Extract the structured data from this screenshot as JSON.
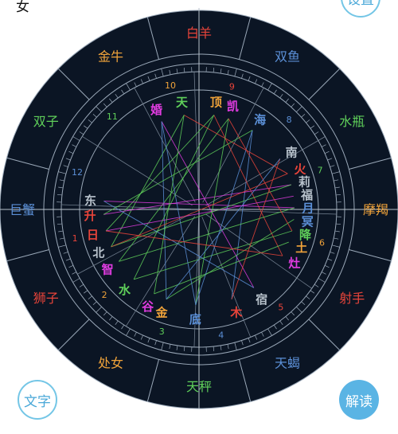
{
  "header": {
    "gender": "女"
  },
  "buttons": {
    "settings": "设置",
    "text": "文字",
    "interpret": "解读"
  },
  "colors": {
    "chart_bg": "#0b1524",
    "ring_line": "#9aa8b8",
    "button_accent": "#5ab4e4"
  },
  "signs": [
    {
      "name": "白羊",
      "color": "#e8443a"
    },
    {
      "name": "双鱼",
      "color": "#5b8fd6"
    },
    {
      "name": "水瓶",
      "color": "#5fcf5a"
    },
    {
      "name": "摩羯",
      "color": "#f0a33a"
    },
    {
      "name": "射手",
      "color": "#e8443a"
    },
    {
      "name": "天蝎",
      "color": "#5b8fd6"
    },
    {
      "name": "天秤",
      "color": "#5fcf5a"
    },
    {
      "name": "处女",
      "color": "#f0a33a"
    },
    {
      "name": "狮子",
      "color": "#e8443a"
    },
    {
      "name": "巨蟹",
      "color": "#5b8fd6"
    },
    {
      "name": "双子",
      "color": "#5fcf5a"
    },
    {
      "name": "金牛",
      "color": "#f0a33a"
    }
  ],
  "houses": [
    {
      "num": "10",
      "color": "#f0a33a"
    },
    {
      "num": "9",
      "color": "#e8443a"
    },
    {
      "num": "8",
      "color": "#5b8fd6"
    },
    {
      "num": "7",
      "color": "#5fcf5a"
    },
    {
      "num": "6",
      "color": "#f0a33a"
    },
    {
      "num": "5",
      "color": "#e8443a"
    },
    {
      "num": "4",
      "color": "#5b8fd6"
    },
    {
      "num": "3",
      "color": "#5fcf5a"
    },
    {
      "num": "2",
      "color": "#f0a33a"
    },
    {
      "num": "1",
      "color": "#e8443a"
    },
    {
      "num": "12",
      "color": "#5b8fd6"
    },
    {
      "num": "11",
      "color": "#5fcf5a"
    }
  ],
  "bodies": [
    {
      "id": "hun",
      "label": "婚",
      "color": "#e03ce0"
    },
    {
      "id": "tian",
      "label": "天",
      "color": "#5fcf5a"
    },
    {
      "id": "ding",
      "label": "顶",
      "color": "#f0a33a"
    },
    {
      "id": "kai",
      "label": "凯",
      "color": "#e03ce0"
    },
    {
      "id": "hai",
      "label": "海",
      "color": "#5b8fd6"
    },
    {
      "id": "nan",
      "label": "南",
      "color": "#b8c2cc"
    },
    {
      "id": "huo",
      "label": "火",
      "color": "#e8443a"
    },
    {
      "id": "li",
      "label": "莉",
      "color": "#b8c2cc"
    },
    {
      "id": "fu",
      "label": "福",
      "color": "#b8c2cc"
    },
    {
      "id": "yue",
      "label": "月",
      "color": "#5b8fd6"
    },
    {
      "id": "ming",
      "label": "冥",
      "color": "#5b8fd6"
    },
    {
      "id": "jiang",
      "label": "降",
      "color": "#5fcf5a"
    },
    {
      "id": "tu",
      "label": "土",
      "color": "#f0a33a"
    },
    {
      "id": "zao",
      "label": "灶",
      "color": "#e03ce0"
    },
    {
      "id": "su",
      "label": "宿",
      "color": "#b8c2cc"
    },
    {
      "id": "mu",
      "label": "木",
      "color": "#e8443a"
    },
    {
      "id": "di",
      "label": "底",
      "color": "#5b8fd6"
    },
    {
      "id": "jin",
      "label": "金",
      "color": "#f0a33a"
    },
    {
      "id": "gu",
      "label": "谷",
      "color": "#e03ce0"
    },
    {
      "id": "shui",
      "label": "水",
      "color": "#5fcf5a"
    },
    {
      "id": "zhi",
      "label": "智",
      "color": "#e03ce0"
    },
    {
      "id": "bei",
      "label": "北",
      "color": "#b8c2cc"
    },
    {
      "id": "ri",
      "label": "日",
      "color": "#e8443a"
    },
    {
      "id": "sheng",
      "label": "升",
      "color": "#e8443a"
    },
    {
      "id": "dong",
      "label": "东",
      "color": "#b8c2cc"
    }
  ]
}
